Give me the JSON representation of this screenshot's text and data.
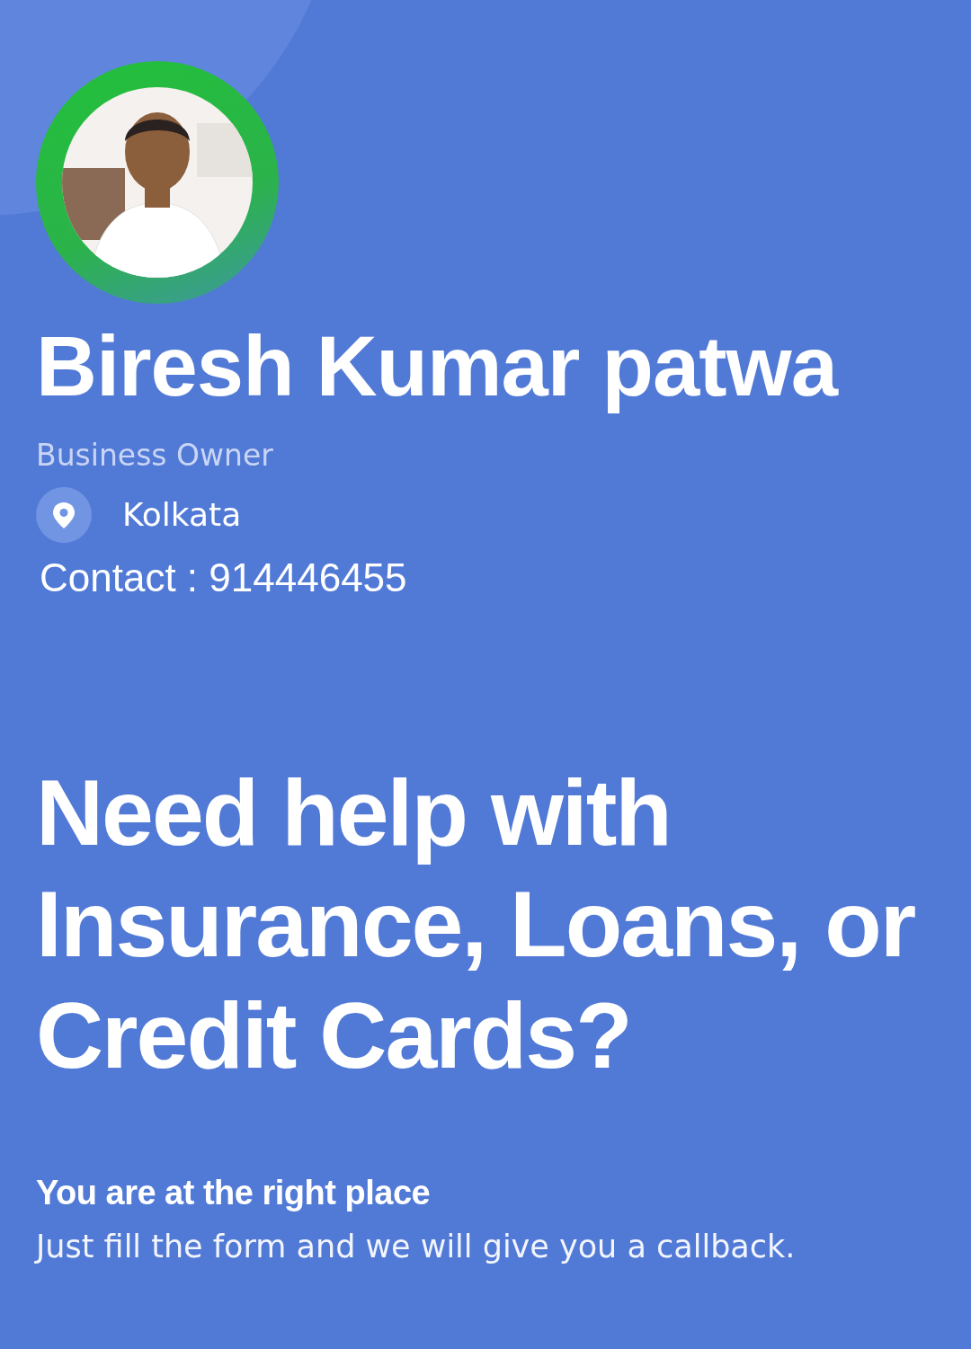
{
  "profile": {
    "name": "Biresh Kumar patwa",
    "role": "Business Owner",
    "location": "Kolkata",
    "contact": "Contact : 914446455"
  },
  "hero": {
    "headline": "Need help with Insurance, Loans, or Credit Cards?",
    "tagline": "You are at the right place",
    "description": "Just fill the form and we will give you a callback."
  }
}
